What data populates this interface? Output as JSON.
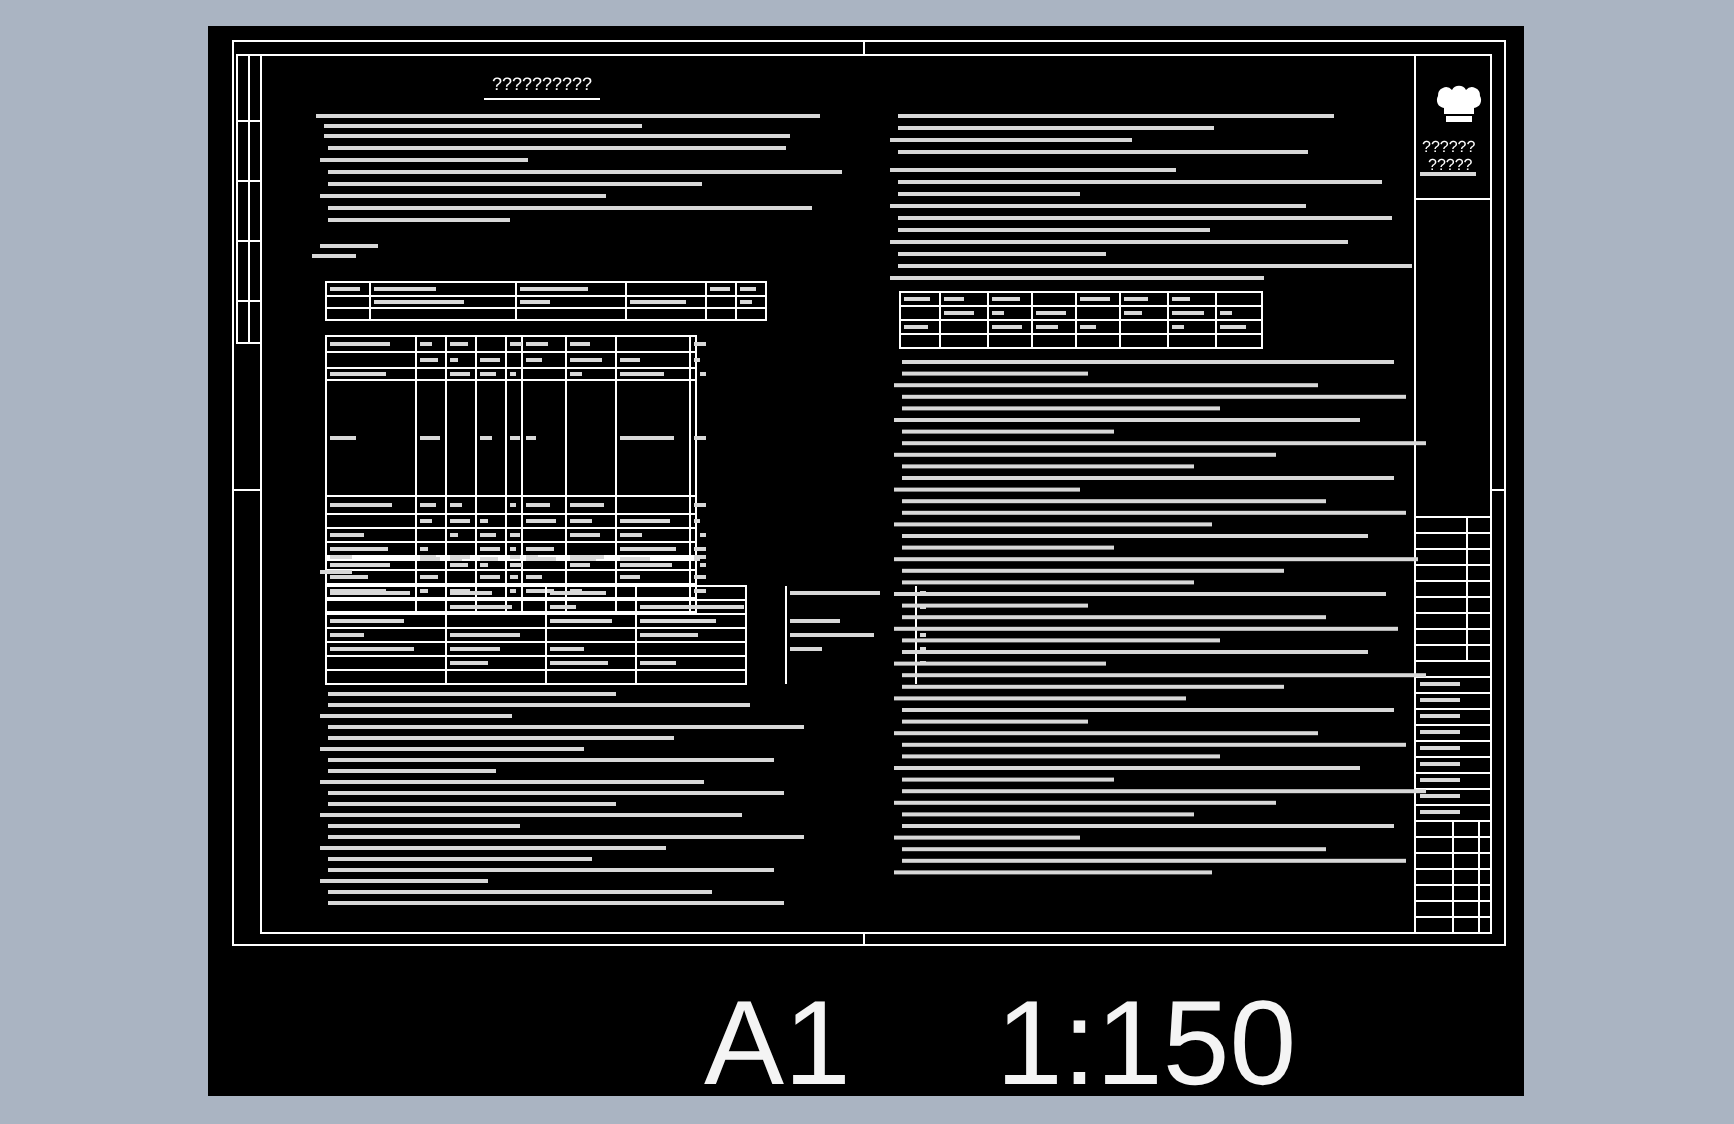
{
  "drawing": {
    "title": "??????????"
  },
  "title_block": {
    "company": "??????",
    "company_sub": "?????"
  },
  "sheet_size": "A1",
  "scale": "1:150"
}
